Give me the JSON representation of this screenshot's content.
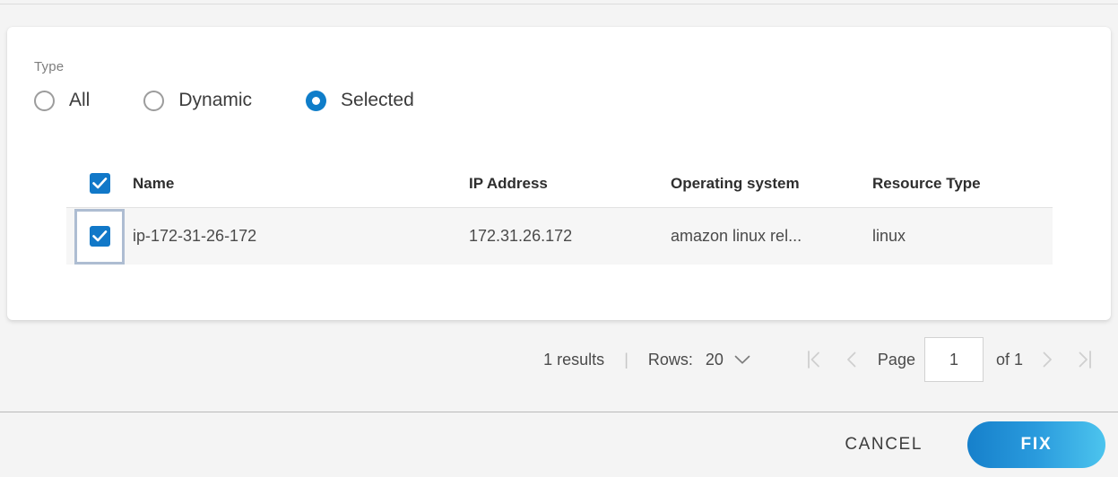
{
  "filter": {
    "label": "Type",
    "options": [
      {
        "label": "All",
        "selected": false
      },
      {
        "label": "Dynamic",
        "selected": false
      },
      {
        "label": "Selected",
        "selected": true
      }
    ]
  },
  "table": {
    "select_all_checked": true,
    "columns": {
      "name": "Name",
      "ip": "IP Address",
      "os": "Operating system",
      "resource_type": "Resource Type"
    },
    "rows": [
      {
        "checked": true,
        "name": "ip-172-31-26-172",
        "ip": "172.31.26.172",
        "os": "amazon linux rel...",
        "resource_type": "linux"
      }
    ]
  },
  "pagination": {
    "results": "1 results",
    "separator": "|",
    "rows_label": "Rows:",
    "rows_value": "20",
    "page_label": "Page",
    "page_value": "1",
    "of_label": "of 1",
    "first_icon": "first-page-icon",
    "prev_icon": "previous-page-icon",
    "next_icon": "next-page-icon",
    "last_icon": "last-page-icon",
    "dropdown_icon": "chevron-down-icon"
  },
  "footer": {
    "cancel_label": "CANCEL",
    "fix_label": "FIX"
  },
  "colors": {
    "accent_blue": "#1178c8",
    "radio_blue": "#0f7dc9",
    "fix_gradient_start": "#1680cb",
    "fix_gradient_end": "#4cc4ee",
    "focus_ring": "#aebdd2",
    "page_bg": "#f4f4f4",
    "row_bg": "#f6f6f6"
  }
}
